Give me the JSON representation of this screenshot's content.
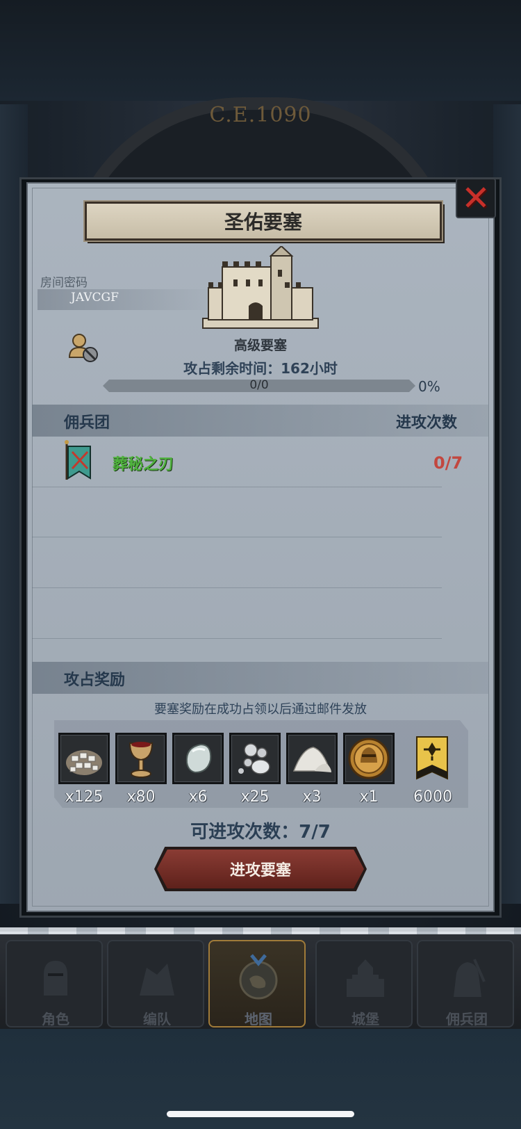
{
  "background": {
    "era_text": "C.E.1090"
  },
  "modal": {
    "title": "圣佑要塞",
    "room_label": "房间密码",
    "room_code": "JAVCGF",
    "castle_type": "高级要塞",
    "remaining_time": "攻占剩余时间：162小时",
    "progress": {
      "text": "0/0",
      "percent_text": "0%",
      "fraction": 0
    },
    "mercenary_section": {
      "title": "佣兵团",
      "right_title": "进攻次数"
    },
    "mercenaries": [
      {
        "name": "葬秘之刃",
        "attacks": "0/7",
        "icon": "banner-icon"
      }
    ],
    "reward_section": {
      "title": "攻占奖励",
      "note": "要塞奖励在成功占领以后通过邮件发放",
      "items": [
        {
          "icon": "silver-ore-sack-icon",
          "qty": "x125"
        },
        {
          "icon": "goblet-icon",
          "qty": "x80"
        },
        {
          "icon": "moonstone-icon",
          "qty": "x6"
        },
        {
          "icon": "mercury-drops-icon",
          "qty": "x25"
        },
        {
          "icon": "salt-pile-icon",
          "qty": "x3"
        },
        {
          "icon": "knight-medal-icon",
          "qty": "x1"
        },
        {
          "icon": "gold-banner-icon",
          "qty": "6000"
        }
      ]
    },
    "attempts_text": "可进攻次数：7/7",
    "attack_button": "进攻要塞"
  },
  "nav": {
    "items": [
      {
        "label": "角色",
        "icon": "knight-helmet-icon",
        "active": false
      },
      {
        "label": "编队",
        "icon": "formation-icon",
        "active": false
      },
      {
        "label": "地图",
        "icon": "map-compass-icon",
        "active": true
      },
      {
        "label": "城堡",
        "icon": "castle-icon",
        "active": false
      },
      {
        "label": "佣兵团",
        "icon": "mercenary-icon",
        "active": false
      }
    ]
  },
  "colors": {
    "panel": "#a6b0bb",
    "merc_name": "#4fb23e",
    "attack_count": "#c2473f",
    "attack_button": "#7a3029",
    "close_x": "#c8302a"
  }
}
